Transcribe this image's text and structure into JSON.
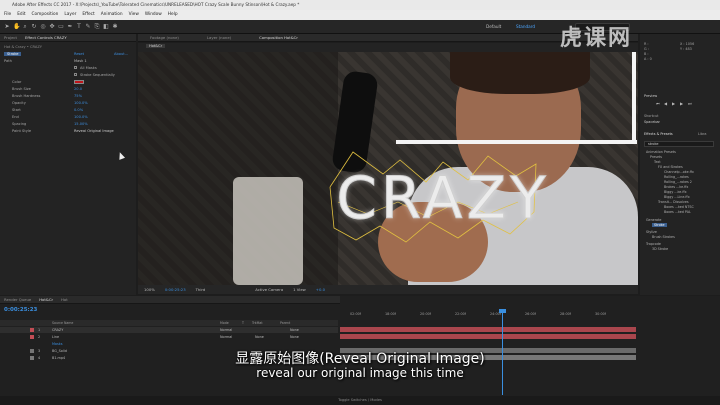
{
  "app": {
    "title": "Adobe After Effects CC 2017 - X:\\Projects\\_YouTube\\Tolerated Cinematics\\UNRELEASED\\HOT Crazy Scale Bunny Stinson\\Hot & Crazy.aep *"
  },
  "menu": [
    "File",
    "Edit",
    "Composition",
    "Layer",
    "Effect",
    "Animation",
    "View",
    "Window",
    "Help"
  ],
  "workspaces": {
    "default": "Default",
    "standard": "Standard",
    "search_placeholder": "Search Help"
  },
  "effect_controls": {
    "tabs": [
      "Project",
      "Effect Controls CRAZY"
    ],
    "breadcrumb": "Hot & Crazy • CRAZY",
    "stroke_label": "Stroke",
    "reset": "Reset",
    "about": "About...",
    "rows": [
      {
        "label": "Path",
        "value": "Mask 1"
      },
      {
        "label": "",
        "value": "All Masks"
      },
      {
        "label": "",
        "value": "Stroke Sequentially"
      },
      {
        "label": "Color",
        "value": ""
      },
      {
        "label": "Brush Size",
        "value": "20.0"
      },
      {
        "label": "Brush Hardness",
        "value": "75%"
      },
      {
        "label": "Opacity",
        "value": "100.0%"
      },
      {
        "label": "Start",
        "value": "0.0%"
      },
      {
        "label": "End",
        "value": "100.0%"
      },
      {
        "label": "Spacing",
        "value": "15.00%"
      },
      {
        "label": "Paint Style",
        "value": "Reveal Original Image"
      }
    ]
  },
  "viewer": {
    "tabs": [
      "Footage (none)",
      "Layer (none)",
      "Composition Hot&Cr"
    ],
    "comp_tab": "Hot&Cr",
    "title_text": "CRAZY",
    "bottom": {
      "zoom": "100%",
      "timecode": "0:00:25:23",
      "quality": "Third",
      "camera": "Active Camera",
      "views": "1 View",
      "exposure": "+0.0"
    }
  },
  "right_panel": {
    "info": [
      "R :",
      "G :",
      "B :",
      "A : 0"
    ],
    "coords": [
      "X : 1056",
      "Y : 483"
    ],
    "preview_label": "Preview",
    "shortcut_label": "Shortcut",
    "shortcut_value": "Spacebar",
    "fx_tab": "Effects & Presets",
    "libraries_tab": "Libra",
    "fx_search": "stroke",
    "fx_tree": [
      "Animation Presets",
      "Presets",
      "Text",
      "FX and Strokes",
      "Channelp...oke.ffx",
      "Rolling_...rokes",
      "Rolling_...rokes 2",
      "Brokes ...ke.ffx",
      "Biggy ...ke.ffx",
      "Biggy ...Line.ffx",
      "Transit... Dissolves",
      "Boxes ...ked NTSC",
      "Boxes ...ked PAL",
      "Generate",
      "Stroke",
      "Stylize",
      "Brush Strokes",
      "Trapcode",
      "3D Stroke"
    ],
    "paragraph_tab": "Paragraph",
    "align_tab": "Align"
  },
  "timeline": {
    "tabs": [
      "Render Queue",
      "Hot&Cr",
      "Hot"
    ],
    "timecode": "0:00:25:23",
    "col_headers": [
      "Source Name",
      "Mode",
      "T",
      "TrkMat",
      "Parent"
    ],
    "layers": [
      {
        "num": "1",
        "name": "CRAZY",
        "mode": "Normal",
        "trkmat": "",
        "parent": "None",
        "color": "#c24d55"
      },
      {
        "num": "2",
        "name": "Line",
        "mode": "Normal",
        "trkmat": "None",
        "parent": "None",
        "color": "#c24d55"
      },
      {
        "num": "",
        "name": "Masks",
        "mode": "",
        "trkmat": "",
        "parent": "",
        "color": "#3a6fae"
      },
      {
        "num": "3",
        "name": "BG_Solid",
        "mode": "",
        "trkmat": "",
        "parent": "",
        "color": "#757575"
      },
      {
        "num": "4",
        "name": "B1.mp4",
        "mode": "",
        "trkmat": "",
        "parent": "",
        "color": "#7a7a7a"
      }
    ],
    "ruler": [
      "02:00f",
      "18:00f",
      "20:00f",
      "22:00f",
      "24:00f",
      "26:00f",
      "28:00f",
      "30:00f",
      "32:00f",
      "34:00f"
    ],
    "toggle_label": "Toggle Switches / Modes"
  },
  "subtitles": {
    "cn": "显露原始图像(Reveal Original Image)",
    "en": "reveal our original image this time"
  },
  "watermark": "虎课网"
}
